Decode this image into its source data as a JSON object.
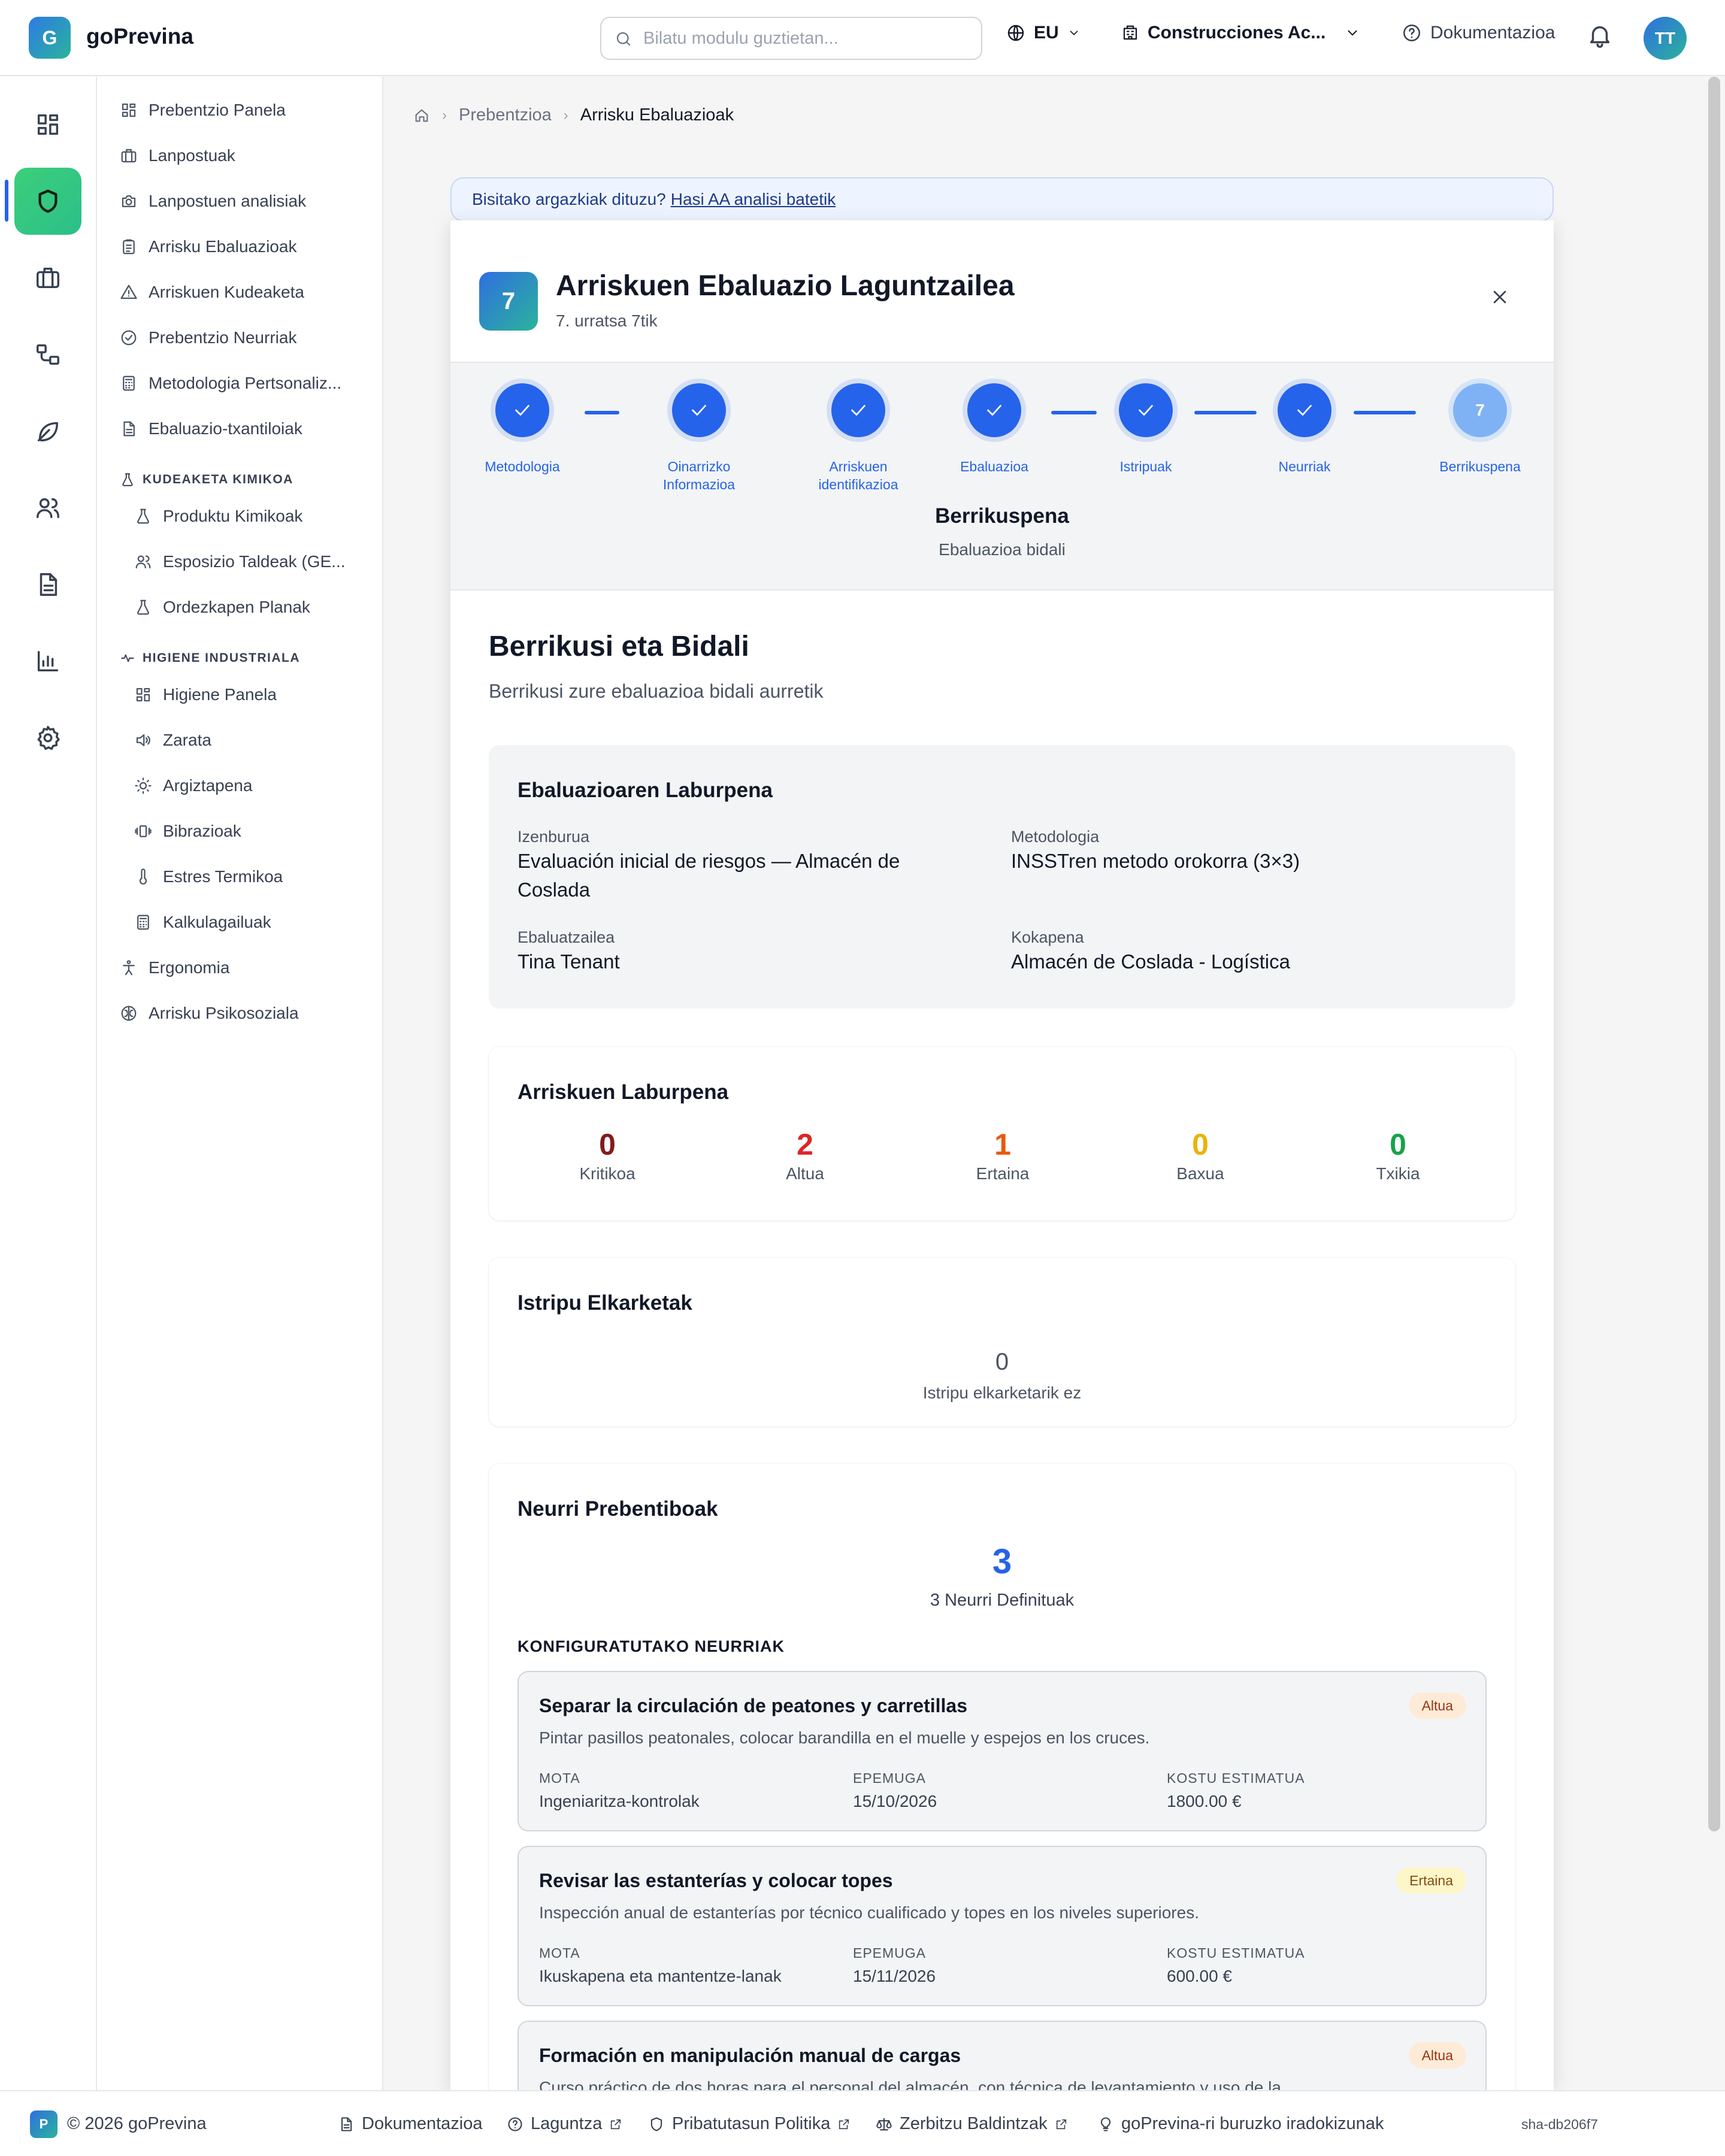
{
  "app": {
    "logo_letter": "G",
    "name": "goPrevina"
  },
  "topbar": {
    "search_placeholder": "Bilatu modulu guztietan...",
    "language": "EU",
    "company": "Construcciones Ac...",
    "docs": "Dokumentazioa",
    "avatar": "TT"
  },
  "rail": {
    "icons": [
      "grid-icon",
      "shield-icon",
      "briefcase-icon",
      "workflow-icon",
      "leaf-icon",
      "users-icon",
      "document-icon",
      "bar-chart-icon",
      "gear-icon"
    ]
  },
  "sidebar": {
    "items": [
      {
        "label": "Prebentzio Panela",
        "icon": "dashboard-icon"
      },
      {
        "label": "Lanpostuak",
        "icon": "briefcase-icon"
      },
      {
        "label": "Lanpostuen analisiak",
        "icon": "camera-icon"
      },
      {
        "label": "Arrisku Ebaluazioak",
        "icon": "clipboard-icon"
      },
      {
        "label": "Arriskuen Kudeaketa",
        "icon": "warning-icon"
      },
      {
        "label": "Prebentzio Neurriak",
        "icon": "check-circle-icon"
      },
      {
        "label": "Metodologia Pertsonaliz...",
        "icon": "calculator-icon"
      },
      {
        "label": "Ebaluazio-txantiloiak",
        "icon": "file-icon"
      }
    ],
    "section_chem": "KUDEAKETA KIMIKOA",
    "chem_items": [
      {
        "label": "Produktu Kimikoak",
        "icon": "flask-icon"
      },
      {
        "label": "Esposizio Taldeak (GE...",
        "icon": "users-icon"
      },
      {
        "label": "Ordezkapen Planak",
        "icon": "flask-icon"
      }
    ],
    "section_hyg": "HIGIENE INDUSTRIALA",
    "hyg_items": [
      {
        "label": "Higiene Panela",
        "icon": "dashboard-icon"
      },
      {
        "label": "Zarata",
        "icon": "speaker-icon"
      },
      {
        "label": "Argiztapena",
        "icon": "sun-icon"
      },
      {
        "label": "Bibrazioak",
        "icon": "vibration-icon"
      },
      {
        "label": "Estres Termikoa",
        "icon": "thermometer-icon"
      },
      {
        "label": "Kalkulagailuak",
        "icon": "calculator-icon"
      }
    ],
    "bottom_items": [
      {
        "label": "Ergonomia",
        "icon": "person-icon"
      },
      {
        "label": "Arrisku Psikosoziala",
        "icon": "brain-icon"
      }
    ]
  },
  "breadcrumb": {
    "parent": "Prebentzioa",
    "current": "Arrisku Ebaluazioak"
  },
  "banner": {
    "text": "Bisitako argazkiak dituzu?",
    "link": "Hasi AA analisi batetik"
  },
  "modal": {
    "step_number": "7",
    "title": "Arriskuen Ebaluazio Laguntzailea",
    "subtitle": "7. urratsa 7tik",
    "steps": [
      {
        "label": "Metodologia",
        "done": true
      },
      {
        "label": "Oinarrizko Informazioa",
        "done": true
      },
      {
        "label": "Arriskuen identifikazioa",
        "done": true
      },
      {
        "label": "Ebaluazioa",
        "done": true
      },
      {
        "label": "Istripuak",
        "done": true
      },
      {
        "label": "Neurriak",
        "done": true
      },
      {
        "label": "Berrikuspena",
        "done": false,
        "number": "7"
      }
    ],
    "current_step_title": "Berrikuspena",
    "current_step_sub": "Ebaluazioa bidali"
  },
  "review": {
    "title": "Berrikusi eta Bidali",
    "subtitle": "Berrikusi zure ebaluazioa bidali aurretik",
    "summary": {
      "title": "Ebaluazioaren Laburpena",
      "name_label": "Izenburua",
      "name_value": "Evaluación inicial de riesgos — Almacén de Coslada",
      "method_label": "Metodologia",
      "method_value": "INSSTren metodo orokorra (3×3)",
      "evaluator_label": "Ebaluatzailea",
      "evaluator_value": "Tina Tenant",
      "location_label": "Kokapena",
      "location_value": "Almacén de Coslada - Logística"
    },
    "risks": {
      "title": "Arriskuen Laburpena",
      "levels": [
        {
          "count": "0",
          "label": "Kritikoa",
          "color": "#7f1d1d"
        },
        {
          "count": "2",
          "label": "Altua",
          "color": "#dc2626"
        },
        {
          "count": "1",
          "label": "Ertaina",
          "color": "#ea580c"
        },
        {
          "count": "0",
          "label": "Baxua",
          "color": "#eab308"
        },
        {
          "count": "0",
          "label": "Txikia",
          "color": "#16a34a"
        }
      ]
    },
    "accidents": {
      "title": "Istripu Elkarketak",
      "count": "0",
      "empty": "Istripu elkarketarik ez"
    },
    "measures": {
      "title": "Neurri Prebentiboak",
      "count": "3",
      "count_label": "3 Neurri Definituak",
      "configured_label": "KONFIGURATUTAKO NEURRIAK",
      "type_label": "MOTA",
      "deadline_label": "EPEMUGA",
      "cost_label": "KOSTU ESTIMATUA",
      "items": [
        {
          "title": "Separar la circulación de peatones y carretillas",
          "desc": "Pintar pasillos peatonales, colocar barandilla en el muelle y espejos en los cruces.",
          "priority": "Altua",
          "type": "Ingeniaritza-kontrolak",
          "deadline": "15/10/2026",
          "cost": "1800.00 €"
        },
        {
          "title": "Revisar las estanterías y colocar topes",
          "desc": "Inspección anual de estanterías por técnico cualificado y topes en los niveles superiores.",
          "priority": "Ertaina",
          "type": "Ikuskapena eta mantentze-lanak",
          "deadline": "15/11/2026",
          "cost": "600.00 €"
        },
        {
          "title": "Formación en manipulación manual de cargas",
          "desc": "Curso práctico de dos horas para el personal del almacén, con técnica de levantamiento y uso de la",
          "priority": "Altua"
        }
      ]
    }
  },
  "footer": {
    "logo_letter": "P",
    "copyright": "© 2026 goPrevina",
    "docs": "Dokumentazioa",
    "help": "Laguntza",
    "privacy": "Pribatutasun Politika",
    "terms": "Zerbitzu Baldintzak",
    "reviews": "goPrevina-ri buruzko iradokizunak",
    "sha": "sha-db206f7"
  }
}
